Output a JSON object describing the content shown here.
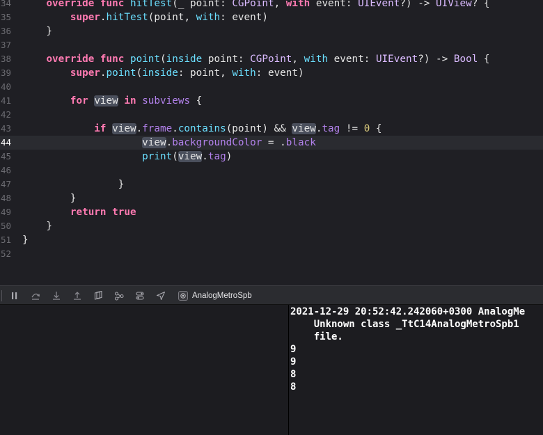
{
  "editor": {
    "current_line": "44",
    "lines": [
      {
        "num": "34",
        "tokens": [
          [
            "    ",
            "pl"
          ],
          [
            "override",
            "kw"
          ],
          [
            " ",
            "pl"
          ],
          [
            "func",
            "kw"
          ],
          [
            " ",
            "pl"
          ],
          [
            "hitTest",
            "fn"
          ],
          [
            "(_ point: ",
            "pl"
          ],
          [
            "CGPoint",
            "cls"
          ],
          [
            ", ",
            "pl"
          ],
          [
            "with",
            "kw"
          ],
          [
            " event: ",
            "pl"
          ],
          [
            "UIEvent",
            "cls"
          ],
          [
            "?) -> ",
            "pl"
          ],
          [
            "UIView",
            "cls"
          ],
          [
            "? {",
            "pl"
          ]
        ]
      },
      {
        "num": "35",
        "tokens": [
          [
            "        ",
            "pl"
          ],
          [
            "super",
            "kw"
          ],
          [
            ".",
            "pl"
          ],
          [
            "hitTest",
            "fn"
          ],
          [
            "(point, ",
            "pl"
          ],
          [
            "with",
            "fn"
          ],
          [
            ": event)",
            "pl"
          ]
        ]
      },
      {
        "num": "36",
        "tokens": [
          [
            "    }",
            "pl"
          ]
        ]
      },
      {
        "num": "37",
        "tokens": []
      },
      {
        "num": "38",
        "tokens": [
          [
            "    ",
            "pl"
          ],
          [
            "override",
            "kw"
          ],
          [
            " ",
            "pl"
          ],
          [
            "func",
            "kw"
          ],
          [
            " ",
            "pl"
          ],
          [
            "point",
            "fn"
          ],
          [
            "(",
            "pl"
          ],
          [
            "inside",
            "fn"
          ],
          [
            " point: ",
            "pl"
          ],
          [
            "CGPoint",
            "cls"
          ],
          [
            ", ",
            "pl"
          ],
          [
            "with",
            "fn"
          ],
          [
            " event: ",
            "pl"
          ],
          [
            "UIEvent",
            "cls"
          ],
          [
            "?) -> ",
            "pl"
          ],
          [
            "Bool",
            "cls"
          ],
          [
            " {",
            "pl"
          ]
        ]
      },
      {
        "num": "39",
        "tokens": [
          [
            "        ",
            "pl"
          ],
          [
            "super",
            "kw"
          ],
          [
            ".",
            "pl"
          ],
          [
            "point",
            "fn"
          ],
          [
            "(",
            "pl"
          ],
          [
            "inside",
            "fn"
          ],
          [
            ": point, ",
            "pl"
          ],
          [
            "with",
            "fn"
          ],
          [
            ": event)",
            "pl"
          ]
        ]
      },
      {
        "num": "40",
        "tokens": []
      },
      {
        "num": "41",
        "tokens": [
          [
            "        ",
            "pl"
          ],
          [
            "for",
            "kw"
          ],
          [
            " ",
            "pl"
          ],
          [
            "view",
            "hl"
          ],
          [
            " ",
            "pl"
          ],
          [
            "in",
            "kw"
          ],
          [
            " ",
            "pl"
          ],
          [
            "subviews",
            "prop"
          ],
          [
            " {",
            "pl"
          ]
        ]
      },
      {
        "num": "42",
        "tokens": []
      },
      {
        "num": "43",
        "tokens": [
          [
            "            ",
            "pl"
          ],
          [
            "if",
            "kw"
          ],
          [
            " ",
            "pl"
          ],
          [
            "view",
            "hl"
          ],
          [
            ".",
            "pl"
          ],
          [
            "frame",
            "prop"
          ],
          [
            ".",
            "pl"
          ],
          [
            "contains",
            "fn"
          ],
          [
            "(point) && ",
            "pl"
          ],
          [
            "view",
            "hl"
          ],
          [
            ".",
            "pl"
          ],
          [
            "tag",
            "prop"
          ],
          [
            " != ",
            "pl"
          ],
          [
            "0",
            "num"
          ],
          [
            " {",
            "pl"
          ]
        ]
      },
      {
        "num": "44",
        "tokens": [
          [
            "                    ",
            "pl"
          ],
          [
            "view",
            "hl"
          ],
          [
            ".",
            "pl"
          ],
          [
            "backgroundColor",
            "prop"
          ],
          [
            " = .",
            "pl"
          ],
          [
            "black",
            "prop"
          ]
        ]
      },
      {
        "num": "45",
        "tokens": [
          [
            "                    ",
            "pl"
          ],
          [
            "print",
            "fn"
          ],
          [
            "(",
            "pl"
          ],
          [
            "view",
            "hl"
          ],
          [
            ".",
            "pl"
          ],
          [
            "tag",
            "prop"
          ],
          [
            ")",
            "pl"
          ]
        ]
      },
      {
        "num": "46",
        "tokens": []
      },
      {
        "num": "47",
        "tokens": [
          [
            "                ",
            "pl"
          ],
          [
            "}",
            "pl"
          ]
        ]
      },
      {
        "num": "48",
        "tokens": [
          [
            "        }",
            "pl"
          ]
        ]
      },
      {
        "num": "49",
        "tokens": [
          [
            "        ",
            "pl"
          ],
          [
            "return",
            "kw"
          ],
          [
            " ",
            "pl"
          ],
          [
            "true",
            "kw"
          ]
        ]
      },
      {
        "num": "50",
        "tokens": [
          [
            "    }",
            "pl"
          ]
        ]
      },
      {
        "num": "51",
        "tokens": [
          [
            "}",
            "pl"
          ]
        ]
      },
      {
        "num": "52",
        "tokens": []
      }
    ]
  },
  "debug_bar": {
    "buttons": [
      {
        "name": "pause-continue-button",
        "icon": "pause-icon"
      },
      {
        "name": "step-over-button",
        "icon": "step-over-icon"
      },
      {
        "name": "step-into-button",
        "icon": "step-into-icon"
      },
      {
        "name": "step-out-button",
        "icon": "step-out-icon"
      },
      {
        "name": "debug-view-hierarchy-button",
        "icon": "view-hierarchy-icon"
      },
      {
        "name": "debug-memory-graph-button",
        "icon": "memory-graph-icon"
      },
      {
        "name": "environment-overrides-button",
        "icon": "environment-overrides-icon"
      },
      {
        "name": "simulate-location-button",
        "icon": "location-arrow-icon"
      }
    ],
    "target_label": "AnalogMetroSpb"
  },
  "console": {
    "lines": [
      "2021-12-29 20:52:42.242060+0300 AnalogMe",
      "    Unknown class _TtC14AnalogMetroSpb1",
      "    file.",
      "9",
      "9",
      "8",
      "8"
    ]
  },
  "colors": {
    "background": "#1f1f24",
    "current_line": "#2a2b30",
    "keyword": "#ff7ab2",
    "function": "#6bdfff",
    "type": "#dabaff",
    "property": "#b281eb",
    "number": "#d9c97c",
    "plain": "#e6e6e6"
  }
}
